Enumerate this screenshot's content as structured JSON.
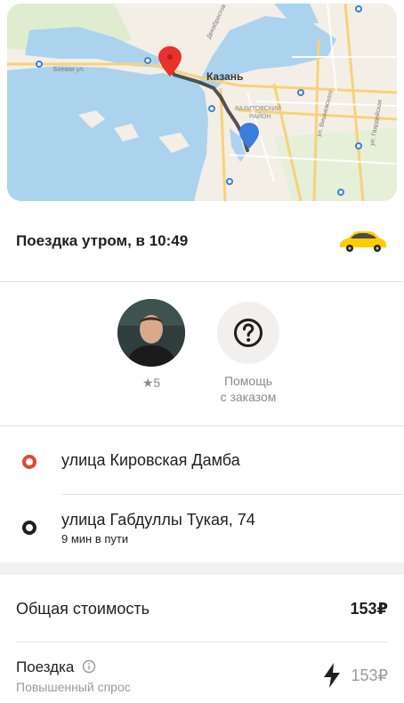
{
  "map": {
    "city_label": "Казань",
    "district_label_1": "ВАХИТОВСКИЙ",
    "district_label_2": "РАЙОН",
    "street_label_1": "Боевая ул.",
    "street_label_2": "ул. Вишневского",
    "street_label_3": "ул. Гвардейская",
    "street_label_4": "Декабристов"
  },
  "trip": {
    "title": "Поездка утром, в 10:49",
    "vehicle_icon": "taxi-car-icon"
  },
  "driver": {
    "rating": "★5"
  },
  "help": {
    "label_line1": "Помощь",
    "label_line2": "с заказом"
  },
  "route": {
    "origin": "улица Кировская Дамба",
    "destination": "улица Габдуллы Тукая, 74",
    "duration": "9 мин в пути"
  },
  "cost": {
    "total_label": "Общая стоимость",
    "total_value": "153₽",
    "ride_label": "Поездка",
    "ride_sublabel": "Повышенный спрос",
    "ride_value": "153₽"
  },
  "colors": {
    "origin_marker": "#e8462f",
    "destination_marker": "#1f1f1f",
    "map_pin_start": "#e8322b",
    "map_pin_end": "#3b7ddd",
    "taxi_yellow": "#ffcc00"
  }
}
